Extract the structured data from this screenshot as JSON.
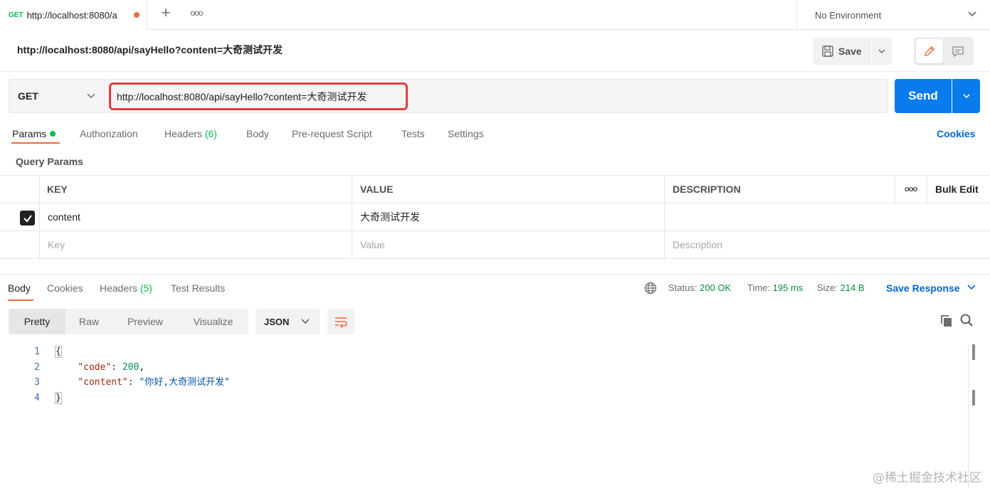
{
  "tab": {
    "method": "GET",
    "title": "http://localhost:8080/a",
    "unsaved_dot_color": "#f26b3a"
  },
  "tab_actions": {
    "new_tab": "+",
    "more": "ooo"
  },
  "environment": {
    "label": "No Environment"
  },
  "request": {
    "title": "http://localhost:8080/api/sayHello?content=大奇测试开发",
    "save_label": "Save",
    "method": "GET",
    "url": "http://localhost:8080/api/sayHello?content=大奇测试开发",
    "send_label": "Send"
  },
  "request_tabs": {
    "params": "Params",
    "authorization": "Authorization",
    "headers": "Headers",
    "headers_count": "(6)",
    "body": "Body",
    "prerequest": "Pre-request Script",
    "tests": "Tests",
    "settings": "Settings",
    "cookies": "Cookies"
  },
  "query_params": {
    "title": "Query Params",
    "columns": {
      "key": "KEY",
      "value": "VALUE",
      "description": "DESCRIPTION",
      "more": "ooo",
      "bulk_edit": "Bulk Edit"
    },
    "rows": [
      {
        "checked": true,
        "key": "content",
        "value": "大奇测试开发",
        "description": ""
      }
    ],
    "placeholders": {
      "key": "Key",
      "value": "Value",
      "description": "Description"
    }
  },
  "response_tabs": {
    "body": "Body",
    "cookies": "Cookies",
    "headers": "Headers",
    "headers_count": "(5)",
    "test_results": "Test Results"
  },
  "response_status": {
    "status_label": "Status:",
    "status_value": "200 OK",
    "time_label": "Time:",
    "time_value": "195 ms",
    "size_label": "Size:",
    "size_value": "214 B",
    "save_response": "Save Response"
  },
  "format": {
    "pretty": "Pretty",
    "raw": "Raw",
    "preview": "Preview",
    "visualize": "Visualize",
    "language": "JSON"
  },
  "response_body": {
    "line_numbers": [
      "1",
      "2",
      "3",
      "4"
    ],
    "open_brace": "{",
    "close_brace": "}",
    "code_key": "\"code\"",
    "code_value": "200",
    "content_key": "\"content\"",
    "content_value": "\"你好,大奇测试开发\""
  },
  "watermark": "@稀土掘金技术社区",
  "colors": {
    "accent_orange": "#f26b3a",
    "send_blue": "#097bed",
    "link_blue": "#0265d2",
    "success_green": "#0cbb52",
    "highlight_red": "#e23d3d"
  }
}
